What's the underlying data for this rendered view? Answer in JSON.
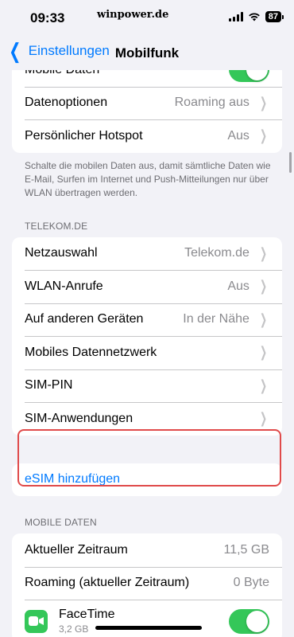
{
  "status": {
    "time": "09:33",
    "watermark": "winpower.de",
    "battery": "87"
  },
  "nav": {
    "back_label": "Einstellungen",
    "title": "Mobilfunk"
  },
  "top_rows": [
    {
      "label": "Mobile Daten",
      "toggle": true
    },
    {
      "label": "Datenoptionen",
      "value": "Roaming aus"
    },
    {
      "label": "Persönlicher Hotspot",
      "value": "Aus"
    }
  ],
  "footer": "Schalte die mobilen Daten aus, damit sämtliche Daten wie E-Mail, Surfen im Internet und Push-Mitteilungen nur über WLAN übertragen werden.",
  "telekom": {
    "header": "TELEKOM.DE",
    "rows": [
      {
        "label": "Netzauswahl",
        "value": "Telekom.de"
      },
      {
        "label": "WLAN-Anrufe",
        "value": "Aus"
      },
      {
        "label": "Auf anderen Geräten",
        "value": "In der Nähe"
      },
      {
        "label": "Mobiles Datennetzwerk",
        "value": ""
      },
      {
        "label": "SIM-PIN",
        "value": ""
      },
      {
        "label": "SIM-Anwendungen",
        "value": ""
      }
    ]
  },
  "esim": {
    "label": "eSIM hinzufügen"
  },
  "mobile_data": {
    "header": "MOBILE DATEN",
    "rows": [
      {
        "label": "Aktueller Zeitraum",
        "value": "11,5 GB"
      },
      {
        "label": "Roaming (aktueller Zeitraum)",
        "value": "0 Byte"
      }
    ],
    "app": {
      "name": "FaceTime",
      "usage": "3,2 GB",
      "toggle": true
    }
  },
  "colors": {
    "accent": "#007aff",
    "toggle_on": "#34c759",
    "highlight": "#e04a4a"
  }
}
